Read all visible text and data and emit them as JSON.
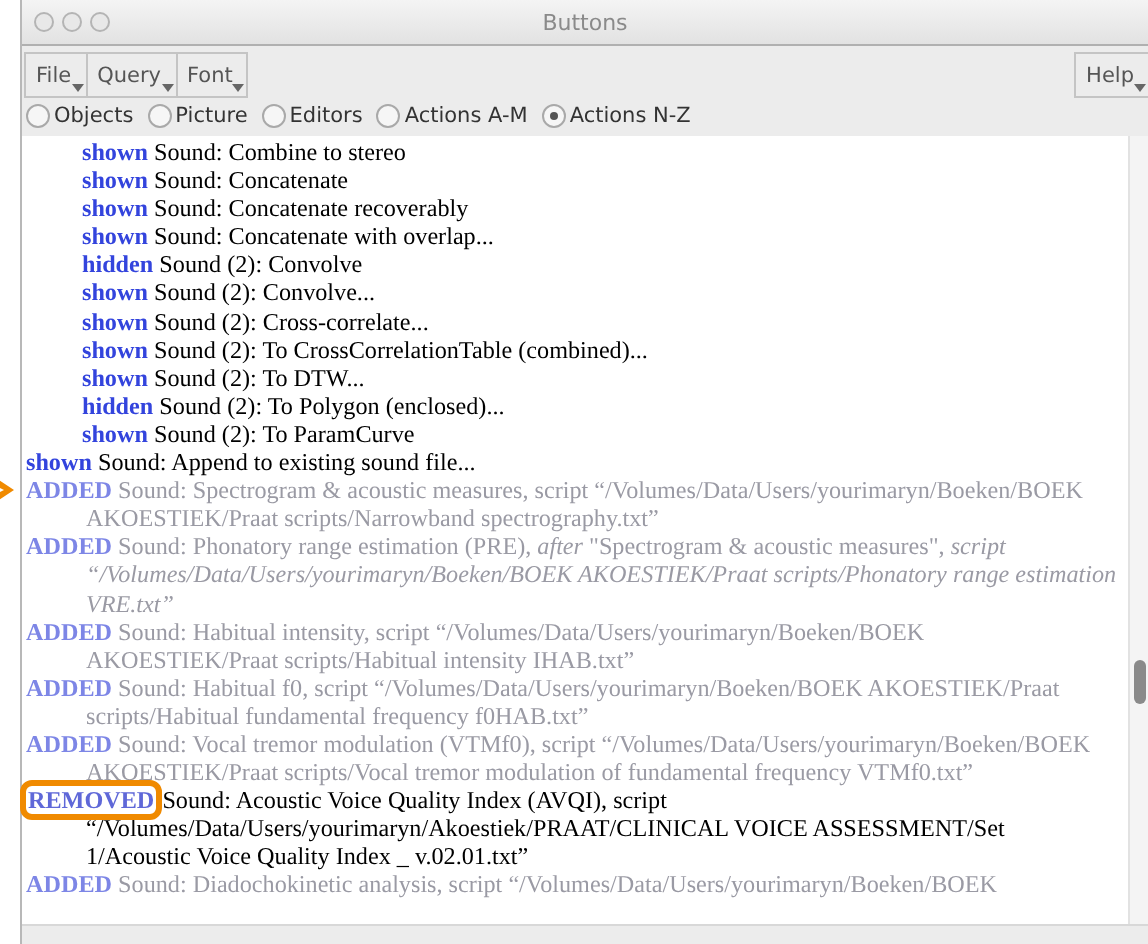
{
  "window": {
    "title": "Buttons"
  },
  "menus": [
    {
      "label": "File"
    },
    {
      "label": "Query"
    },
    {
      "label": "Font"
    }
  ],
  "help_menu": {
    "label": "Help"
  },
  "radio_tabs": [
    {
      "label": "Objects",
      "selected": false
    },
    {
      "label": "Picture",
      "selected": false
    },
    {
      "label": "Editors",
      "selected": false
    },
    {
      "label": "Actions A-M",
      "selected": false
    },
    {
      "label": "Actions N-Z",
      "selected": true
    }
  ],
  "sub_entries": [
    {
      "tag": "shown",
      "lines": [
        "Sound: Combine to stereo"
      ]
    },
    {
      "tag": "shown",
      "lines": [
        "Sound: Concatenate"
      ]
    },
    {
      "tag": "shown",
      "lines": [
        "Sound: Concatenate recoverably"
      ]
    },
    {
      "tag": "shown",
      "lines": [
        "Sound: Concatenate with overlap..."
      ]
    },
    {
      "tag": "hidden",
      "lines": [
        "Sound (2): Convolve"
      ]
    },
    {
      "tag": "shown",
      "lines": [
        "Sound (2): Convolve..."
      ]
    },
    {
      "tag": "shown",
      "lines": [
        "Sound (2): Cross-correlate..."
      ]
    },
    {
      "tag": "shown",
      "lines": [
        "Sound (2): To CrossCorrelationTable (combined)..."
      ]
    },
    {
      "tag": "shown",
      "lines": [
        "Sound (2): To DTW..."
      ]
    },
    {
      "tag": "hidden",
      "lines": [
        "Sound (2): To Polygon (enclosed)..."
      ]
    },
    {
      "tag": "shown",
      "lines": [
        "Sound (2): To ParamCurve"
      ]
    }
  ],
  "entries": [
    {
      "tag": "shown",
      "faded": false,
      "highlighted": false,
      "pointer": false,
      "lines": [
        "Sound: Append to existing sound file..."
      ]
    },
    {
      "tag": "ADDED",
      "faded": true,
      "highlighted": false,
      "pointer": true,
      "lines": [
        "Sound: Spectrogram & acoustic measures, script “/Volumes/Data/Users/yourimaryn/Boeken/BOEK",
        "AKOESTIEK/Praat scripts/Narrowband spectrography.txt”"
      ]
    },
    {
      "tag": "ADDED",
      "faded": true,
      "highlighted": false,
      "pointer": false,
      "lines": [
        "Sound: Phonatory range estimation (PRE), *after* \"Spectrogram & acoustic measures\", *script*",
        "*“/Volumes/Data/Users/yourimaryn/Boeken/BOEK AKOESTIEK/Praat scripts/Phonatory range estimation*",
        "*VRE.txt”*"
      ]
    },
    {
      "tag": "ADDED",
      "faded": true,
      "highlighted": false,
      "pointer": false,
      "lines": [
        "Sound: Habitual intensity, script “/Volumes/Data/Users/yourimaryn/Boeken/BOEK",
        "AKOESTIEK/Praat scripts/Habitual intensity IHAB.txt”"
      ]
    },
    {
      "tag": "ADDED",
      "faded": true,
      "highlighted": false,
      "pointer": false,
      "lines": [
        "Sound: Habitual f0, script “/Volumes/Data/Users/yourimaryn/Boeken/BOEK AKOESTIEK/Praat",
        "scripts/Habitual fundamental frequency f0HAB.txt”"
      ]
    },
    {
      "tag": "ADDED",
      "faded": true,
      "highlighted": false,
      "pointer": false,
      "lines": [
        "Sound: Vocal tremor modulation (VTMf0), script “/Volumes/Data/Users/yourimaryn/Boeken/BOEK",
        "AKOESTIEK/Praat scripts/Vocal tremor modulation of fundamental frequency VTMf0.txt”"
      ]
    },
    {
      "tag": "REMOVED",
      "faded": false,
      "highlighted": true,
      "pointer": false,
      "lines": [
        "Sound: Acoustic Voice Quality Index (AVQI), script",
        "“/Volumes/Data/Users/yourimaryn/Akoestiek/PRAAT/CLINICAL VOICE ASSESSMENT/Set",
        "1/Acoustic Voice Quality Index _ v.02.01.txt”"
      ]
    },
    {
      "tag": "ADDED",
      "faded": true,
      "highlighted": false,
      "pointer": false,
      "lines": [
        "Sound: Diadochokinetic analysis, script “/Volumes/Data/Users/yourimaryn/Boeken/BOEK"
      ]
    }
  ]
}
